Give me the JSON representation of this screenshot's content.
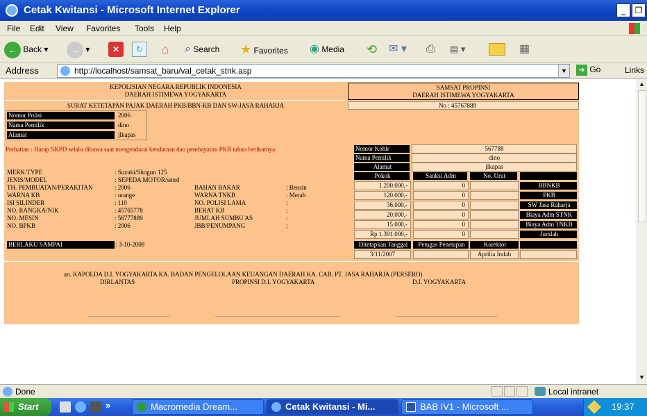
{
  "window": {
    "title": "Cetak Kwitansi - Microsoft Internet Explorer"
  },
  "menu": [
    "File",
    "Edit",
    "View",
    "Favorites",
    "Tools",
    "Help"
  ],
  "toolbar": {
    "back": "Back",
    "search": "Search",
    "favorites": "Favorites",
    "media": "Media"
  },
  "address": {
    "label": "Address",
    "url": "http://localhost/samsat_baru/val_cetak_stnk.asp",
    "go": "Go",
    "links": "Links"
  },
  "doc": {
    "header_left_1": "KEPOLISIAN NEGARA REPUBLIK INDONESIA",
    "header_left_2": "DAERAH ISTIMEWA YOGYAKARTA",
    "header_right_1": "SAMSAT PROPINSI",
    "header_right_2": "DAERAH ISTIMEWA YOGYAKARTA",
    "subtitle": "SURAT KETETAPAN PAJAK DAERAH PKB/BBN-KB DAN SW-JASA RAHARJA",
    "no_label": "No :",
    "no_value": "45767889",
    "owner": {
      "nopol_label": "Nomor Polisi",
      "nopol": "2006",
      "nama_label": "Nama Pemilik",
      "nama": "dino",
      "alamat_label": "Alamat",
      "alamat": "jlkapas"
    },
    "notice": "Perhatian : Harap SKPD selalu dibawa saat mengendarai kendaraan dan pembayaran PKB tahun berikutnya",
    "vehicle": {
      "merk_label": "MERK/TYPE",
      "merk": ": Suzuki/Shogun 125",
      "jenis_label": "JENIS/MODEL",
      "jenis": ": SEPEDA MOTOR/smrd",
      "th_label": "TH. PEMBUATAN/PERAKITAN",
      "th": ": 2006",
      "warna_label": "WARNA KB",
      "warna": ": orange",
      "isi_label": "ISI SILINDER",
      "isi": ": 110",
      "rangka_label": "NO. RANGKA/NIK",
      "rangka": ": 45765778",
      "mesin_label": "NO. MESIN",
      "mesin": ": 56777889",
      "bpkb_label": "NO. BPKB",
      "bpkb": ": 2006",
      "bahan_label": "BAHAN BAKAR",
      "bahan": ": Bensin",
      "warnatnkb_label": "WARNA TNKB",
      "warnatnkb": ": Merah",
      "polisi_lama_label": "NO. POLISI LAMA",
      "polisi_lama": ":",
      "berat_label": "BERAT KB",
      "berat": ":",
      "sumbu_label": "JUMLAH SUMBU AS",
      "sumbu": ":",
      "jbb_label": "JBB/PENUMPANG",
      "jbb": ":",
      "berlaku_label": "BERLAKU SAMPAI",
      "berlaku": ": 3-10-2008"
    },
    "kohir": {
      "kohir_label": "Nomor Kohir",
      "kohir": "567788",
      "nama_label": "Nama Pemilik",
      "nama": "dino",
      "alamat_label": "Alamat",
      "alamat": "jlkapas"
    },
    "pay_headers": [
      "Pokok",
      "Sanksi Adm",
      "No. Urut"
    ],
    "pay_rows": [
      {
        "pokok": "1.200.000,-",
        "sanksi": "0",
        "label": "BBNKB"
      },
      {
        "pokok": "120.000,-",
        "sanksi": "0",
        "label": "PKB"
      },
      {
        "pokok": "36.000,-",
        "sanksi": "0",
        "label": "SW Jasa Raharja"
      },
      {
        "pokok": "20.000,-",
        "sanksi": "0",
        "label": "Biaya Adm STNK"
      },
      {
        "pokok": "15.000,-",
        "sanksi": "0",
        "label": "Biaya Adm TNKB"
      },
      {
        "pokok": "Rp 1.391.000,-",
        "sanksi": "0",
        "label": "Jumlah"
      }
    ],
    "sign_headers": [
      "Ditetapkan Tanggal",
      "Petugas Penetapan",
      "Korektor"
    ],
    "sign_values": [
      "3/11/2007",
      "",
      "Aprilia Indah"
    ],
    "footer_line1": "an. KAPOLDA D.I. YOGYAKARTA  KA. BADAN PENGELOLAAN KEUANGAN DAERAH  KA. CAB. PT. JASA RAHARJA (PERSERO)",
    "footer_l": "DIRLANTAS",
    "footer_m": "PROPINSI D.I. YOGYAKARTA",
    "footer_r": "D.I. YOGYAKARTA"
  },
  "status": {
    "text": "Done",
    "zone": "Local intranet"
  },
  "taskbar": {
    "start": "Start",
    "tasks": [
      "Macromedia Dream...",
      "Cetak Kwitansi - Mi...",
      "BAB IV1 - Microsoft ..."
    ],
    "time": "19:37"
  }
}
